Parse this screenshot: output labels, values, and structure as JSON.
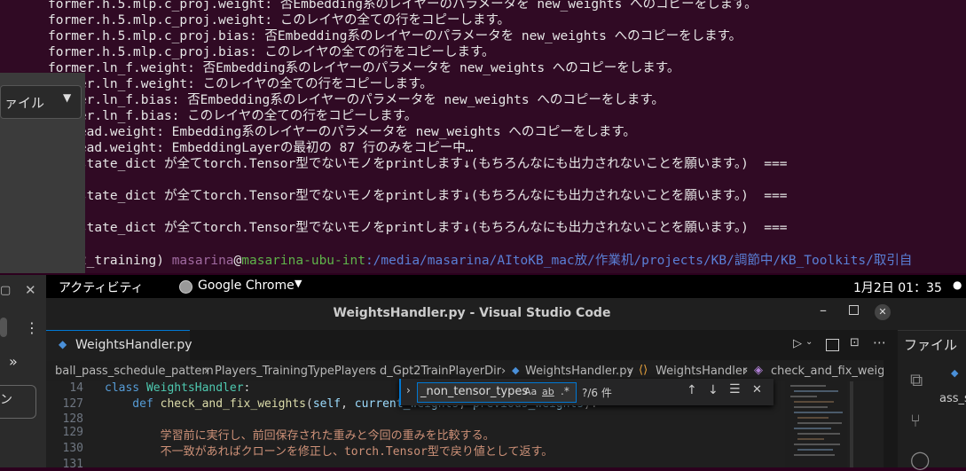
{
  "terminal": {
    "lines": [
      "former.h.5.mlp.c_proj.weight: 否Embedding系のレイヤーのパラメータを new_weights へのコピーをします。",
      "former.h.5.mlp.c_proj.weight: このレイヤの全ての行をコピーします。",
      "former.h.5.mlp.c_proj.bias: 否Embedding系のレイヤーのパラメータを new_weights へのコピーをします。",
      "former.h.5.mlp.c_proj.bias: このレイヤの全ての行をコピーします。",
      "former.ln_f.weight: 否Embedding系のレイヤーのパラメータを new_weights へのコピーをします。",
      "former.ln_f.weight: このレイヤの全ての行をコピーします。",
      "former.ln_f.bias: 否Embedding系のレイヤーのパラメータを new_weights へのコピーをします。",
      "former.ln_f.bias: このレイヤの全ての行をコピーします。"
    ],
    "lm_lines": [
      "lm_head.weight: Embedding系のレイヤーのパラメータを new_weights へのコピーをします。",
      "lm_head.weight: EmbeddingLayerの最初の 87 行のみをコピー中…"
    ],
    "state_line": "=== state_dict が全てtorch.Tensor型でないモノをprintします↓(もちろんなにも出力されないことを願います。)  ===",
    "moon": "🌙",
    "prompt": {
      "env": "(gpt2_training)",
      "user": "masarina",
      "at": "@",
      "host": "masarina-ubu-int",
      "path": ":/media/masarina/AItoKB_mac放/作業机/projects/KB/調節中/KB_Toolkits/取引自"
    }
  },
  "left_panel": {
    "dropdown_label": "ァイル"
  },
  "gnome_bar": {
    "activities": "アクティビティ",
    "app_name": "Google Chrome",
    "clock": "1月2日  01：35"
  },
  "vscode": {
    "title": "WeightsHandler.py - Visual Studio Code",
    "tab_label": "WeightsHandler.py",
    "breadcrumb": [
      "ball_pass_schedule_pattern",
      "Players_TrainingTypePlayers",
      "d_Gpt2TrainPlayerDir",
      "WeightsHandler.py",
      "WeightsHandler",
      "check_and_fix_weights"
    ],
    "find": {
      "query": "_non_tensor_types",
      "case": "Aa",
      "word": "ab",
      "regex": ".*",
      "result": "?/6 件"
    },
    "editor": {
      "lines": [
        {
          "num": "14",
          "parts": [
            {
              "t": "class ",
              "c": "#569cd6"
            },
            {
              "t": "WeightsHandler",
              "c": "#4ec9b0"
            },
            {
              "t": ":",
              "c": "#d4d4d4"
            }
          ]
        },
        {
          "num": "127",
          "parts": [
            {
              "t": "    def ",
              "c": "#569cd6"
            },
            {
              "t": "check_and_fix_weights",
              "c": "#dcdcaa"
            },
            {
              "t": "(",
              "c": "#d4d4d4"
            },
            {
              "t": "self",
              "c": "#9cdcfe"
            },
            {
              "t": ", ",
              "c": "#d4d4d4"
            },
            {
              "t": "current_weights",
              "c": "#9cdcfe"
            },
            {
              "t": ", ",
              "c": "#d4d4d4"
            },
            {
              "t": "previous_weights",
              "c": "#9cdcfe"
            },
            {
              "t": "):",
              "c": "#d4d4d4"
            }
          ]
        },
        {
          "num": "128",
          "parts": [
            {
              "t": "",
              "c": "#d4d4d4"
            }
          ]
        },
        {
          "num": "129",
          "parts": [
            {
              "t": "        学習前に実行し、前回保存された重みと今回の重みを比較する。",
              "c": "#ce9178"
            }
          ]
        },
        {
          "num": "130",
          "parts": [
            {
              "t": "        不一致があればクローンを修正し、torch.Tensor型で戻り値として返す。",
              "c": "#ce9178"
            }
          ]
        },
        {
          "num": "131",
          "parts": [
            {
              "t": "",
              "c": "#d4d4d4"
            }
          ]
        }
      ]
    }
  },
  "right_window": {
    "label": "ファイル",
    "partial_text": "ass_s"
  },
  "colors": {
    "terminal_bg": "#300a24",
    "vscode_bg": "#1e1e1e",
    "accent": "#0e639c"
  }
}
